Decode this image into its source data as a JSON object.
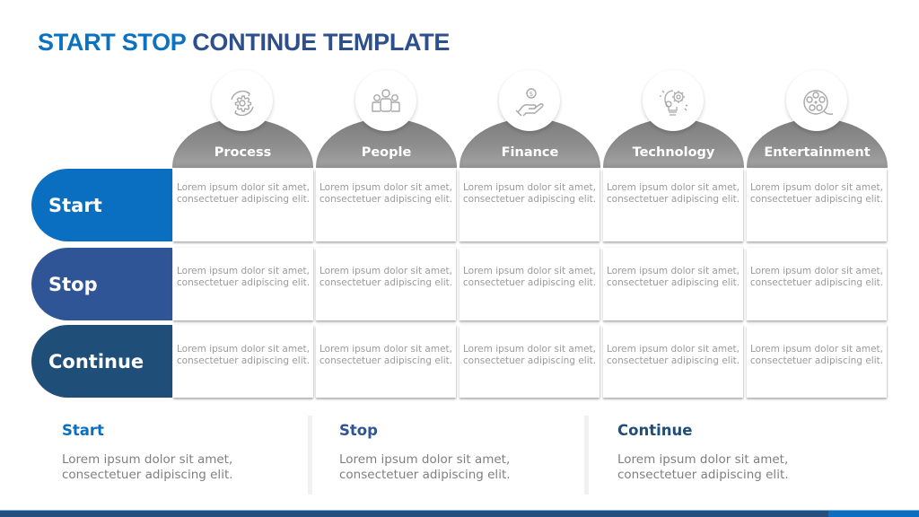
{
  "title": {
    "part1": "START STOP",
    "part2": "CONTINUE TEMPLATE"
  },
  "columns": [
    {
      "label": "Process",
      "icon": "gear-cycle-icon"
    },
    {
      "label": "People",
      "icon": "people-group-icon"
    },
    {
      "label": "Finance",
      "icon": "hand-coin-icon"
    },
    {
      "label": "Technology",
      "icon": "lightbulb-gears-icon"
    },
    {
      "label": "Entertainment",
      "icon": "film-reel-icon"
    }
  ],
  "rows": [
    {
      "label": "Start",
      "color": "#0a6fc0",
      "cells": [
        "Lorem ipsum dolor sit amet, consectetuer adipiscing elit.",
        "Lorem ipsum dolor sit amet, consectetuer adipiscing elit.",
        "Lorem ipsum dolor sit amet, consectetuer adipiscing elit.",
        "Lorem ipsum dolor sit amet, consectetuer adipiscing elit.",
        "Lorem ipsum dolor sit amet, consectetuer adipiscing elit."
      ]
    },
    {
      "label": "Stop",
      "color": "#2f5597",
      "cells": [
        "Lorem ipsum dolor sit amet, consectetuer adipiscing elit.",
        "Lorem ipsum dolor sit amet, consectetuer adipiscing elit.",
        "Lorem ipsum dolor sit amet, consectetuer adipiscing elit.",
        "Lorem ipsum dolor sit amet, consectetuer adipiscing elit.",
        "Lorem ipsum dolor sit amet, consectetuer adipiscing elit."
      ]
    },
    {
      "label": "Continue",
      "color": "#1f4e79",
      "cells": [
        "Lorem ipsum dolor sit amet, consectetuer adipiscing elit.",
        "Lorem ipsum dolor sit amet, consectetuer adipiscing elit.",
        "Lorem ipsum dolor sit amet, consectetuer adipiscing elit.",
        "Lorem ipsum dolor sit amet, consectetuer adipiscing elit.",
        "Lorem ipsum dolor sit amet, consectetuer adipiscing elit."
      ]
    }
  ],
  "summary": [
    {
      "heading": "Start",
      "color": "#0a6fc0",
      "text": "Lorem ipsum dolor sit amet, consectetuer adipiscing elit."
    },
    {
      "heading": "Stop",
      "color": "#2f5597",
      "text": "Lorem ipsum dolor sit amet, consectetuer adipiscing elit."
    },
    {
      "heading": "Continue",
      "color": "#1f4e79",
      "text": "Lorem ipsum dolor sit amet, consectetuer adipiscing elit."
    }
  ],
  "colors": {
    "title_start_stop": "#0a72c1",
    "title_rest": "#2d4f8e",
    "footer": "#234e7e",
    "footer_accent": "#0a6fc0"
  }
}
